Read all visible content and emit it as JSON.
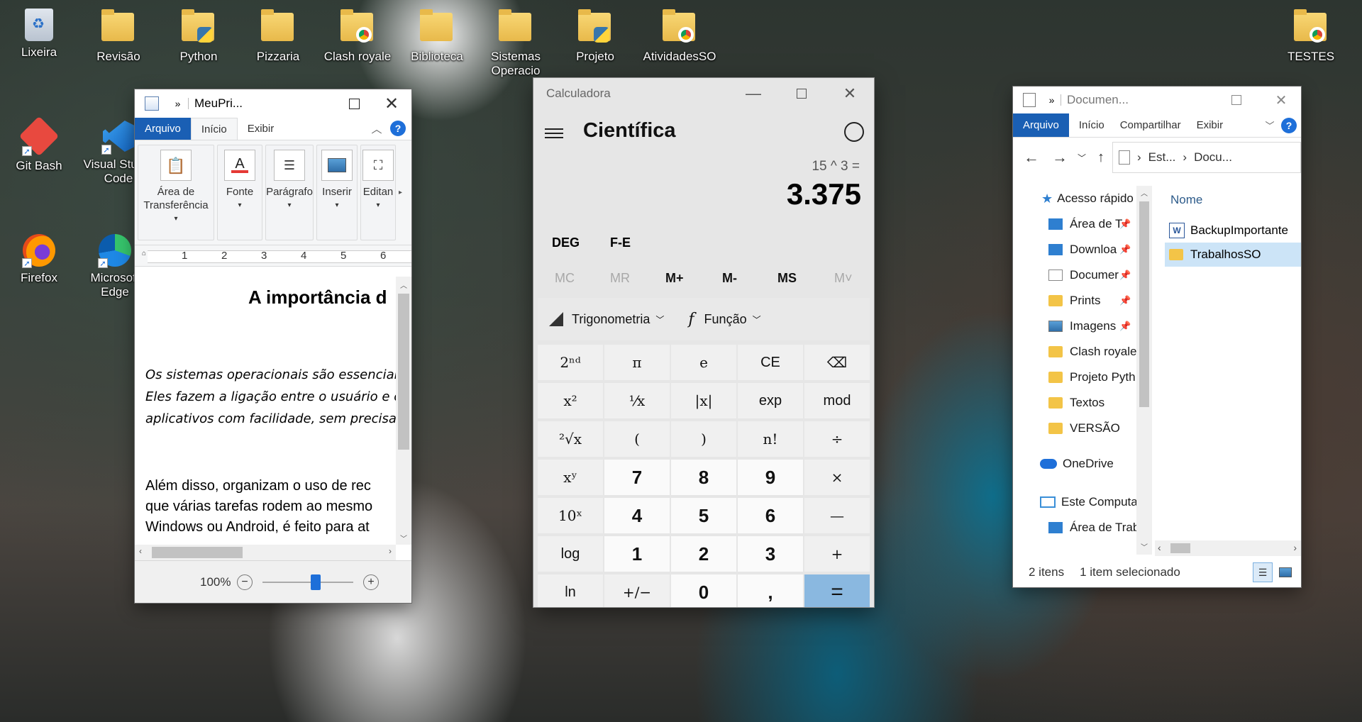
{
  "desktop": {
    "icons_top": [
      {
        "label": "Lixeira",
        "type": "recycle"
      },
      {
        "label": "Revisão",
        "type": "folder"
      },
      {
        "label": "Python",
        "type": "python-file"
      },
      {
        "label": "Pizzaria",
        "type": "folder"
      },
      {
        "label": "Clash royale",
        "type": "chrome-file"
      },
      {
        "label": "Biblioteca",
        "type": "folder"
      },
      {
        "label": "Sistemas Operacio",
        "type": "folder"
      },
      {
        "label": "Projeto",
        "type": "python-file"
      },
      {
        "label": "AtividadesSO",
        "type": "chrome-file"
      },
      {
        "label": "TESTES",
        "type": "chrome-file"
      }
    ],
    "icons_left": [
      {
        "label": "Git Bash",
        "type": "git-bash"
      },
      {
        "label": "Visual Studio Code",
        "type": "vscode"
      },
      {
        "label": "Firefox",
        "type": "firefox"
      },
      {
        "label": "Microsoft Edge",
        "type": "edge"
      }
    ]
  },
  "wordpad": {
    "title": "MeuPri...",
    "tabs": {
      "file": "Arquivo",
      "home": "Início",
      "view": "Exibir"
    },
    "groups": {
      "clipboard": "Área de Transferência",
      "font": "Fonte",
      "paragraph": "Parágrafo",
      "insert": "Inserir",
      "edit": "Editan"
    },
    "ruler_marks": [
      "1",
      "2",
      "3",
      "4",
      "5",
      "6"
    ],
    "doc": {
      "heading": "A importância d",
      "para1": [
        "Os sistemas operacionais são essenciai",
        "Eles fazem a ligação entre o usuário e o",
        "aplicativos com facilidade, sem precisa"
      ],
      "para2": [
        "Além disso, organizam o uso de rec",
        "que várias tarefas rodem ao mesmo",
        "Windows ou Android, é feito para at"
      ]
    },
    "zoom": "100%",
    "zoom_level_pct": 60
  },
  "calculator": {
    "title": "Calculadora",
    "mode": "Científica",
    "expression": "15 ^ 3 =",
    "result": "3.375",
    "angle_unit": "DEG",
    "fe": "F-E",
    "memory": [
      "MC",
      "MR",
      "M+",
      "M-",
      "MS",
      "M˅"
    ],
    "trig_label": "Trigonometria",
    "func_label": "Função",
    "keys": [
      [
        "2ⁿᵈ",
        "π",
        "e",
        "CE",
        "⌫"
      ],
      [
        "x²",
        "¹⁄x",
        "|x|",
        "exp",
        "mod"
      ],
      [
        "²√x",
        "(",
        ")",
        "n!",
        "÷"
      ],
      [
        "xʸ",
        "7",
        "8",
        "9",
        "×"
      ],
      [
        "10ˣ",
        "4",
        "5",
        "6",
        "—"
      ],
      [
        "log",
        "1",
        "2",
        "3",
        "+"
      ],
      [
        "ln",
        "+/−",
        "0",
        ",",
        "="
      ]
    ]
  },
  "explorer": {
    "title": "Documen...",
    "tabs": {
      "file": "Arquivo",
      "home": "Início",
      "share": "Compartilhar",
      "view": "Exibir"
    },
    "breadcrumb": [
      "Est...",
      "Docu..."
    ],
    "column_header": "Nome",
    "nav": {
      "quick_access": "Acesso rápido",
      "items": [
        "Área de T",
        "Downloa",
        "Documer",
        "Prints",
        "Imagens",
        "Clash royale",
        "Projeto Pyth",
        "Textos",
        "VERSÃO"
      ],
      "onedrive": "OneDrive",
      "this_pc": "Este Computa",
      "pc_items": [
        "Área de Trab"
      ]
    },
    "files": [
      {
        "name": "BackupImportante",
        "type": "word-doc"
      },
      {
        "name": "TrabalhosSO",
        "type": "folder",
        "selected": true
      }
    ],
    "status_count": "2 itens",
    "status_selected": "1 item selecionado"
  }
}
